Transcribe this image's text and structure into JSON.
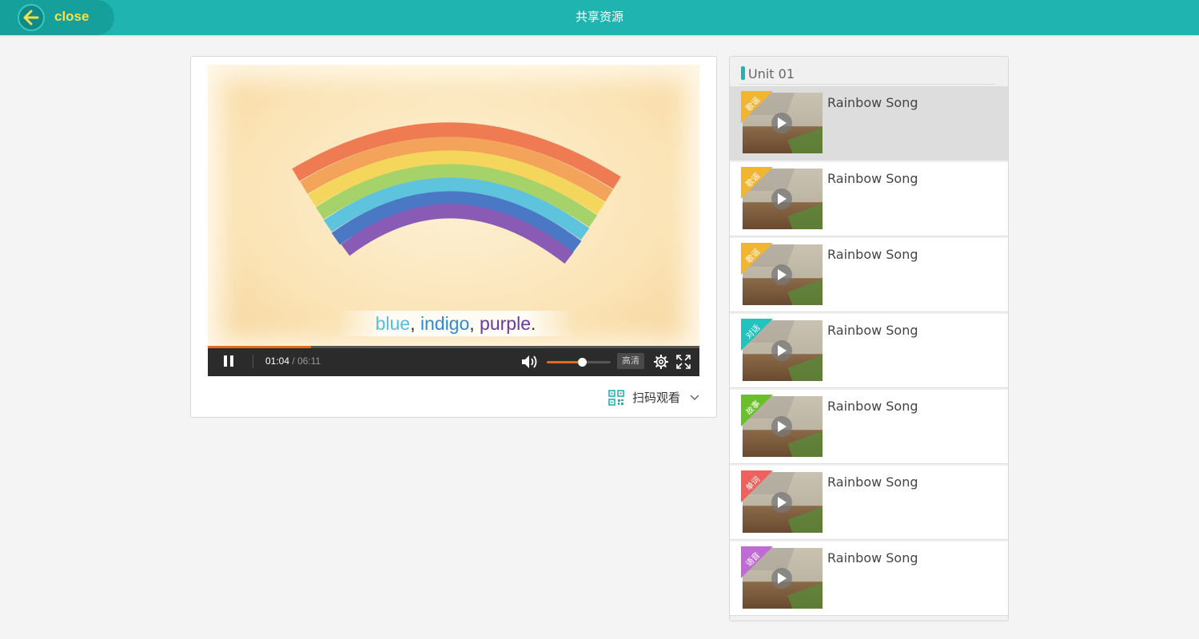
{
  "header": {
    "close_label": "close",
    "title": "共享资源"
  },
  "player": {
    "caption": {
      "word1": "blue",
      "comma1": ",",
      "word2": "indigo",
      "comma2": ",",
      "word3": "purple",
      "period": "."
    },
    "current_time": "01:04",
    "time_sep": "/",
    "duration": "06:11",
    "progress_fraction": 0.21,
    "volume_fraction": 0.55,
    "quality_label": "高清",
    "scan_label": "扫码观看",
    "accent_color": "#e36a1e"
  },
  "playlist": {
    "unit_title": "Unit 01",
    "items": [
      {
        "title": "Rainbow Song",
        "tag": "歌谣",
        "tag_color": "#f2b530",
        "active": true
      },
      {
        "title": "Rainbow Song",
        "tag": "歌谣",
        "tag_color": "#f2b530",
        "active": false
      },
      {
        "title": "Rainbow Song",
        "tag": "歌谣",
        "tag_color": "#f2b530",
        "active": false
      },
      {
        "title": "Rainbow Song",
        "tag": "对话",
        "tag_color": "#23c3bd",
        "active": false
      },
      {
        "title": "Rainbow Song",
        "tag": "故事",
        "tag_color": "#6abf2c",
        "active": false
      },
      {
        "title": "Rainbow Song",
        "tag": "单词",
        "tag_color": "#f0605f",
        "active": false
      },
      {
        "title": "Rainbow Song",
        "tag": "语音",
        "tag_color": "#c06ad6",
        "active": false
      }
    ]
  },
  "colors": {
    "brand": "#1fb4b0",
    "close_text": "#f4e04d"
  },
  "icons": [
    "back-arrow-icon",
    "pause-icon",
    "volume-icon",
    "gear-icon",
    "fullscreen-icon",
    "qr-code-icon",
    "chevron-down-icon",
    "play-icon"
  ]
}
